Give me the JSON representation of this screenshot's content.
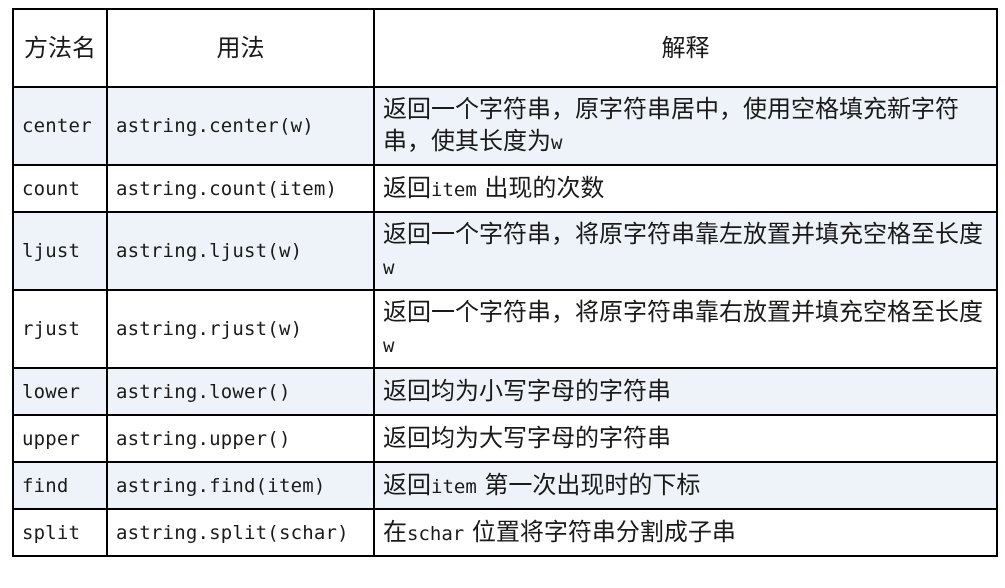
{
  "table": {
    "headers": [
      "方法名",
      "用法",
      "解释"
    ],
    "rows": [
      {
        "name": "center",
        "usage": "astring.center(w)",
        "desc_parts": [
          "返回一个字符串，原字符串居中，使用空格填充新字符串，使其长度为",
          "w",
          ""
        ],
        "shaded": true,
        "tall": true
      },
      {
        "name": "count",
        "usage": "astring.count(item)",
        "desc_parts": [
          "返回",
          "item",
          " 出现的次数"
        ],
        "shaded": false,
        "tall": false
      },
      {
        "name": "ljust",
        "usage": "astring.ljust(w)",
        "desc_parts": [
          "返回一个字符串，将原字符串靠左放置并填充空格至长度",
          "w",
          ""
        ],
        "shaded": true,
        "tall": true
      },
      {
        "name": "rjust",
        "usage": "astring.rjust(w)",
        "desc_parts": [
          "返回一个字符串，将原字符串靠右放置并填充空格至长度",
          "w",
          ""
        ],
        "shaded": false,
        "tall": true
      },
      {
        "name": "lower",
        "usage": "astring.lower()",
        "desc_parts": [
          "返回均为小写字母的字符串",
          "",
          ""
        ],
        "shaded": true,
        "tall": false
      },
      {
        "name": "upper",
        "usage": "astring.upper()",
        "desc_parts": [
          "返回均为大写字母的字符串",
          "",
          ""
        ],
        "shaded": false,
        "tall": false
      },
      {
        "name": "find",
        "usage": "astring.find(item)",
        "desc_parts": [
          "返回",
          "item",
          " 第一次出现时的下标"
        ],
        "shaded": true,
        "tall": false
      },
      {
        "name": "split",
        "usage": "astring.split(schar)",
        "desc_parts": [
          "在",
          "schar",
          " 位置将字符串分割成子串"
        ],
        "shaded": false,
        "tall": false
      }
    ]
  },
  "colors": {
    "shaded_row": "#eef3fa",
    "border": "#000000"
  }
}
